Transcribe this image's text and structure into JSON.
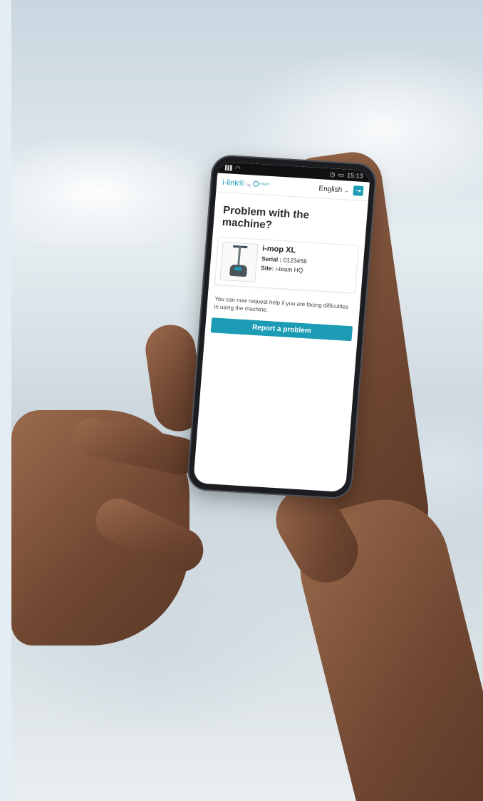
{
  "statusbar": {
    "time": "15:13"
  },
  "header": {
    "brand": "i-link®",
    "by": "by",
    "maker": "i-team",
    "language": "English",
    "language_chevron": "⌄",
    "logout_glyph": "⇥"
  },
  "page": {
    "title": "Problem with the machine?",
    "machine": {
      "model": "i-mop XL",
      "serial_label": "Serial :",
      "serial_value": "0123456",
      "site_label": "Site:",
      "site_value": "i-team HQ"
    },
    "help_text": "You can now request help if you are facing difficulties in using the machine.",
    "report_label": "Report a problem"
  },
  "colors": {
    "accent": "#1c9bb5",
    "text": "#2a2d30",
    "phone_frame": "#1b1d21"
  },
  "icons": [
    "signal-icon",
    "wifi-icon",
    "alarm-icon",
    "battery-icon",
    "chevron-down-icon",
    "logout-icon",
    "machine-photo"
  ]
}
